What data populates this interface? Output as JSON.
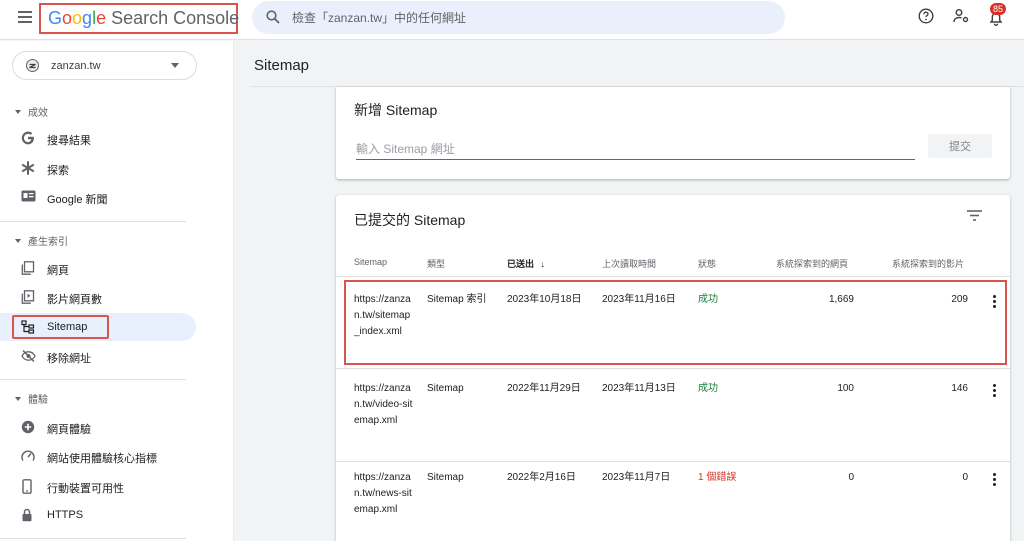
{
  "app": {
    "logo": {
      "google": [
        "G",
        "o",
        "o",
        "g",
        "l",
        "e"
      ],
      "product": "Search Console"
    },
    "search_placeholder": "檢查「zanzan.tw」中的任何網址",
    "notification_count": "85"
  },
  "sidebar": {
    "property": "zanzan.tw",
    "sections": [
      {
        "label": "成效",
        "items": [
          {
            "label": "搜尋結果",
            "icon": "google-g-icon"
          },
          {
            "label": "探索",
            "icon": "asterisk-icon"
          },
          {
            "label": "Google 新聞",
            "icon": "news-icon"
          }
        ]
      },
      {
        "label": "產生索引",
        "items": [
          {
            "label": "網頁",
            "icon": "pages-icon"
          },
          {
            "label": "影片網頁數",
            "icon": "video-page-icon"
          },
          {
            "label": "Sitemap",
            "icon": "sitemap-icon",
            "active": true
          },
          {
            "label": "移除網址",
            "icon": "eye-off-icon"
          }
        ]
      },
      {
        "label": "體驗",
        "items": [
          {
            "label": "網頁體驗",
            "icon": "plus-circle-icon"
          },
          {
            "label": "網站使用體驗核心指標",
            "icon": "speedometer-icon"
          },
          {
            "label": "行動裝置可用性",
            "icon": "phone-icon"
          },
          {
            "label": "HTTPS",
            "icon": "lock-icon"
          }
        ]
      }
    ]
  },
  "main": {
    "title": "Sitemap",
    "add_card": {
      "title": "新增 Sitemap",
      "placeholder": "輸入 Sitemap 網址",
      "submit_label": "提交"
    },
    "submitted_card": {
      "title": "已提交的 Sitemap",
      "columns": [
        "Sitemap",
        "類型",
        "已送出",
        "上次讀取時間",
        "狀態",
        "系統探索到的網頁",
        "系統探索到的影片"
      ],
      "sort_indicator": "↓",
      "rows": [
        {
          "sitemap": "https://zanzan.tw/sitemap_index.xml",
          "type": "Sitemap 索引",
          "submitted": "2023年10月18日",
          "last_read": "2023年11月16日",
          "status": "成功",
          "status_kind": "ok",
          "pages": "1,669",
          "videos": "209"
        },
        {
          "sitemap": "https://zanzan.tw/video-sitemap.xml",
          "type": "Sitemap",
          "submitted": "2022年11月29日",
          "last_read": "2023年11月13日",
          "status": "成功",
          "status_kind": "ok",
          "pages": "100",
          "videos": "146"
        },
        {
          "sitemap": "https://zanzan.tw/news-sitemap.xml",
          "type": "Sitemap",
          "submitted": "2022年2月16日",
          "last_read": "2023年11月7日",
          "status": "1 個錯誤",
          "status_kind": "err",
          "pages": "0",
          "videos": "0"
        }
      ]
    }
  },
  "colors": {
    "accent": "#1a73e8",
    "success": "#188038",
    "error": "#d93025",
    "highlight_box": "#d9534f"
  }
}
